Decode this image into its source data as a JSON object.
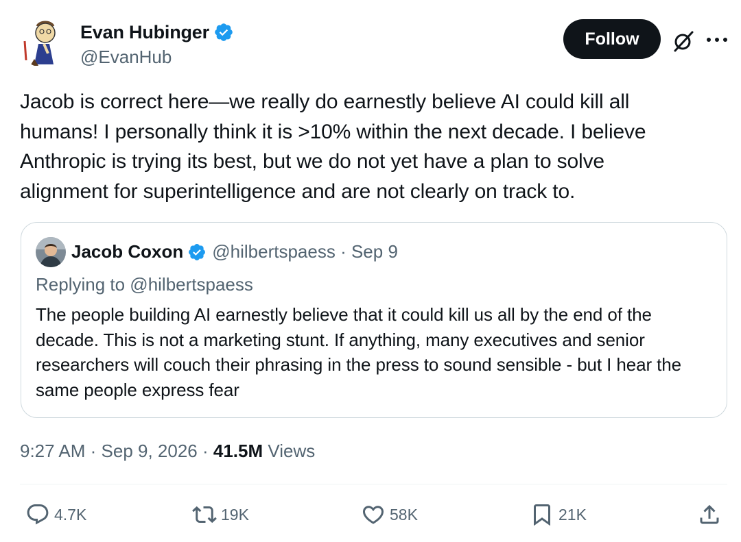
{
  "author": {
    "name": "Evan Hubinger",
    "handle": "@EvanHub"
  },
  "follow_label": "Follow",
  "tweet_text": "Jacob is correct here—we really do earnestly believe AI could kill all\nhumans! I personally think it is >10% within the next decade. I believe\nAnthropic is trying its best, but we do not yet have a plan to solve\nalignment for superintelligence and are not clearly on track to.",
  "quote": {
    "name": "Jacob Coxon",
    "handle": "@hilbertspaess",
    "date": "Sep 9",
    "replying_to": "Replying to @hilbertspaess",
    "text": "The people building AI earnestly believe that it could kill us all by the end of the decade. This is not a marketing stunt. If anything, many executives and senior researchers will couch their phrasing in the press to sound sensible - but I hear the same people express fear"
  },
  "meta": {
    "time": "9:27 AM",
    "date": "Sep 9, 2026",
    "views_count": "41.5M",
    "views_label": "Views"
  },
  "actions": {
    "replies": "4.7K",
    "reposts": "19K",
    "likes": "58K",
    "bookmarks": "21K"
  },
  "colors": {
    "text": "#0f1419",
    "secondary": "#536471",
    "verified": "#1d9bf0",
    "border": "#cfd9de"
  },
  "icons": [
    "verified-badge-icon",
    "grok-icon",
    "more-icon",
    "reply-icon",
    "repost-icon",
    "like-icon",
    "bookmark-icon",
    "share-icon"
  ]
}
